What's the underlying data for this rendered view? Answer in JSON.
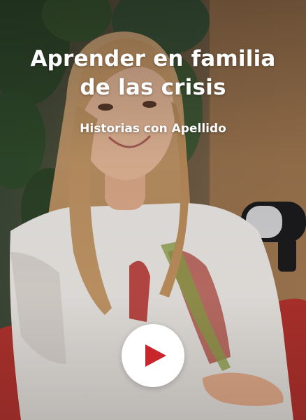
{
  "card": {
    "title": "Aprender en familia de las crisis",
    "subtitle": "Historias con Apellido"
  },
  "video": {
    "play_icon": "play-icon",
    "accent_color": "#c8262b"
  }
}
